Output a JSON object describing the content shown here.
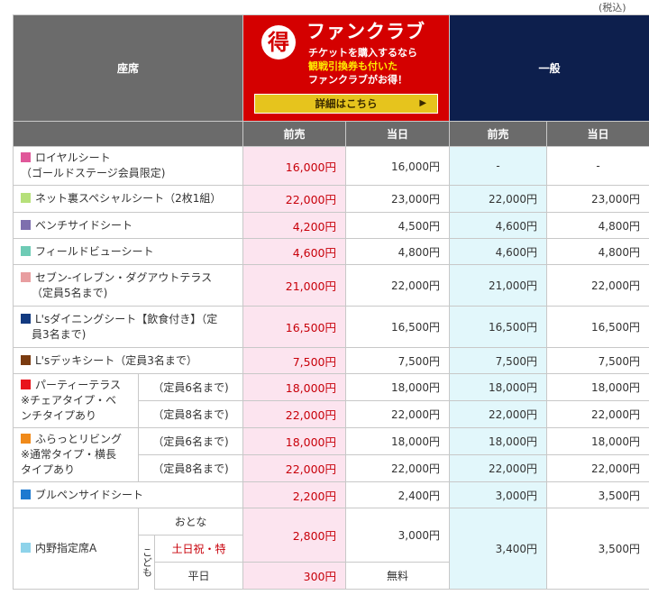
{
  "tax_note": "(税込)",
  "header": {
    "seat_label": "座席",
    "fanclub": {
      "logo_char": "得",
      "title": "ファンクラブ",
      "line1": "チケットを購入するなら",
      "line2": "観戦引換券も付いた",
      "line3": "ファンクラブがお得！",
      "button_label": "詳細はこちら",
      "button_arrow": "▶"
    },
    "general_label": "一般",
    "sub": {
      "fan_pre": "前売",
      "fan_day": "当日",
      "gen_pre": "前売",
      "gen_day": "当日"
    }
  },
  "colors": {
    "royal": "#e0589a",
    "netura": "#b6e07a",
    "bench": "#7e6fae",
    "field": "#6ecbb5",
    "seven": "#e89ea0",
    "dining": "#123a80",
    "deck": "#7a3b10",
    "party": "#e8141c",
    "furatto": "#f08a1a",
    "bullpen": "#1f7ad0",
    "uchino": "#8ed3ea"
  },
  "rows": {
    "royal": {
      "name1": "ロイヤルシート",
      "name2": "（ゴールドステージ会員限定)",
      "fp": "16,000円",
      "fd": "16,000円",
      "gp": "-",
      "gd": "-"
    },
    "netura": {
      "name": "ネット裏スペシャルシート（2枚1組）",
      "fp": "22,000円",
      "fd": "23,000円",
      "gp": "22,000円",
      "gd": "23,000円"
    },
    "bench": {
      "name": "ベンチサイドシート",
      "fp": "4,200円",
      "fd": "4,500円",
      "gp": "4,600円",
      "gd": "4,800円"
    },
    "field": {
      "name": "フィールドビューシート",
      "fp": "4,600円",
      "fd": "4,800円",
      "gp": "4,600円",
      "gd": "4,800円"
    },
    "seven": {
      "name1": "セブン-イレブン・ダグアウトテラス",
      "name2": "（定員5名まで)",
      "fp": "21,000円",
      "fd": "22,000円",
      "gp": "21,000円",
      "gd": "22,000円"
    },
    "dining": {
      "name1": "L'sダイニングシート【飲食付き】（定",
      "name2": "員3名まで)",
      "fp": "16,500円",
      "fd": "16,500円",
      "gp": "16,500円",
      "gd": "16,500円"
    },
    "deck": {
      "name": "L'sデッキシート（定員3名まで）",
      "fp": "7,500円",
      "fd": "7,500円",
      "gp": "7,500円",
      "gd": "7,500円"
    },
    "party": {
      "name1": "パーティーテラス",
      "name2": "※チェアタイプ・ベ",
      "name3": "ンチタイプあり",
      "sub1": "（定員6名まで)",
      "fp1": "18,000円",
      "fd1": "18,000円",
      "gp1": "18,000円",
      "gd1": "18,000円",
      "sub2": "（定員8名まで)",
      "fp2": "22,000円",
      "fd2": "22,000円",
      "gp2": "22,000円",
      "gd2": "22,000円"
    },
    "furatto": {
      "name1": "ふらっとリビング",
      "name2": "※通常タイプ・横長",
      "name3": "タイプあり",
      "sub1": "（定員6名まで)",
      "fp1": "18,000円",
      "fd1": "18,000円",
      "gp1": "18,000円",
      "gd1": "18,000円",
      "sub2": "（定員8名まで)",
      "fp2": "22,000円",
      "fd2": "22,000円",
      "gp2": "22,000円",
      "gd2": "22,000円"
    },
    "bullpen": {
      "name": "ブルペンサイドシート",
      "fp": "2,200円",
      "fd": "2,400円",
      "gp": "3,000円",
      "gd": "3,500円"
    },
    "uchino": {
      "name": "内野指定席A",
      "adult": "おとな",
      "child": "こども",
      "holiday": "土日祝・特",
      "weekday": "平日",
      "fp_adult_holiday": "2,800円",
      "fd_adult_holiday": "3,000円",
      "fp_weekday": "300円",
      "fd_weekday": "無料",
      "gp": "3,400円",
      "gd": "3,500円"
    }
  }
}
